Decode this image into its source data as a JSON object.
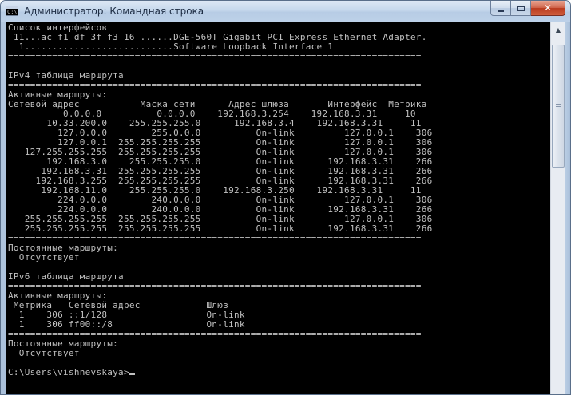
{
  "window": {
    "title": "Администратор: Командная строка",
    "icon_text": "C:\\",
    "buttons": {
      "minimize": "minimize-icon",
      "maximize": "maximize-icon",
      "close": "close-icon"
    }
  },
  "console": {
    "prompt": "C:\\Users\\vishnevskaya>",
    "lines": [
      "Список интерфейсов",
      " 11...ac f1 df 3f f3 16 ......DGE-560T Gigabit PCI Express Ethernet Adapter.",
      "  1...........................Software Loopback Interface 1",
      "===========================================================================",
      "",
      "IPv4 таблица маршрута",
      "===========================================================================",
      "Активные маршруты:",
      "Сетевой адрес           Маска сети      Адрес шлюза       Интерфейс  Метрика",
      "          0.0.0.0          0.0.0.0    192.168.3.254    192.168.3.31     10",
      "       10.33.200.0    255.255.255.0      192.168.3.4    192.168.3.31     11",
      "         127.0.0.0        255.0.0.0          On-link         127.0.0.1    306",
      "         127.0.0.1  255.255.255.255          On-link         127.0.0.1    306",
      "   127.255.255.255  255.255.255.255          On-link         127.0.0.1    306",
      "       192.168.3.0    255.255.255.0          On-link      192.168.3.31    266",
      "      192.168.3.31  255.255.255.255          On-link      192.168.3.31    266",
      "     192.168.3.255  255.255.255.255          On-link      192.168.3.31    266",
      "      192.168.11.0    255.255.255.0    192.168.3.250    192.168.3.31     11",
      "         224.0.0.0        240.0.0.0          On-link         127.0.0.1    306",
      "         224.0.0.0        240.0.0.0          On-link      192.168.3.31    266",
      "   255.255.255.255  255.255.255.255          On-link         127.0.0.1    306",
      "   255.255.255.255  255.255.255.255          On-link      192.168.3.31    266",
      "===========================================================================",
      "Постоянные маршруты:",
      "  Отсутствует",
      "",
      "IPv6 таблица маршрута",
      "===========================================================================",
      "Активные маршруты:",
      " Метрика   Сетевой адрес            Шлюз",
      "  1    306 ::1/128                  On-link",
      "  1    306 ff00::/8                 On-link",
      "===========================================================================",
      "Постоянные маршруты:",
      "  Отсутствует",
      ""
    ]
  },
  "scrollbar": {
    "up_icon": "scroll-up-arrow-icon"
  }
}
